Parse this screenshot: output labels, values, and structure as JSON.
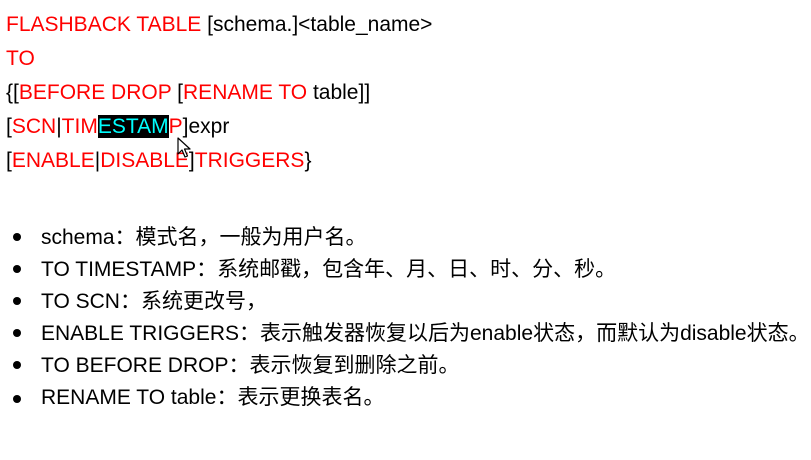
{
  "syntax": {
    "line1": {
      "kw": "FLASHBACK TABLE",
      "rest": " [schema.]<table_name>"
    },
    "line2": {
      "kw": "TO"
    },
    "line3": {
      "p1": "{[",
      "kw1": "BEFORE DROP",
      "p2": " [",
      "kw2": "RENAME TO",
      "p3": " table]]"
    },
    "line4": {
      "p1": "[",
      "kw1": "SCN",
      "p2": "|",
      "kw2a": "TIM",
      "sel": "ESTAM",
      "kw2b": "P",
      "p3": "]expr"
    },
    "line5": {
      "p1": "[",
      "kw1": "ENABLE",
      "p2": "|",
      "kw2": "DISABLE",
      "p3": "]",
      "kw3": "TRIGGERS",
      "p4": "}"
    }
  },
  "bullets": [
    {
      "text": "schema：模式名，一般为用户名。"
    },
    {
      "text": "TO TIMESTAMP：系统邮戳，包含年、月、日、时、分、秒。"
    },
    {
      "text": "TO SCN：系统更改号，"
    },
    {
      "text": "ENABLE TRIGGERS：表示触发器恢复以后为enable状态，而默认为disable状态。"
    },
    {
      "text": "TO BEFORE DROP：表示恢复到删除之前。"
    },
    {
      "text": "RENAME TO table：表示更换表名。"
    }
  ],
  "colors": {
    "keyword": "#ff0000",
    "selection_bg": "#000000",
    "selection_fg": "#00ffff"
  },
  "icons": {
    "cursor": "mouse-pointer-icon"
  }
}
